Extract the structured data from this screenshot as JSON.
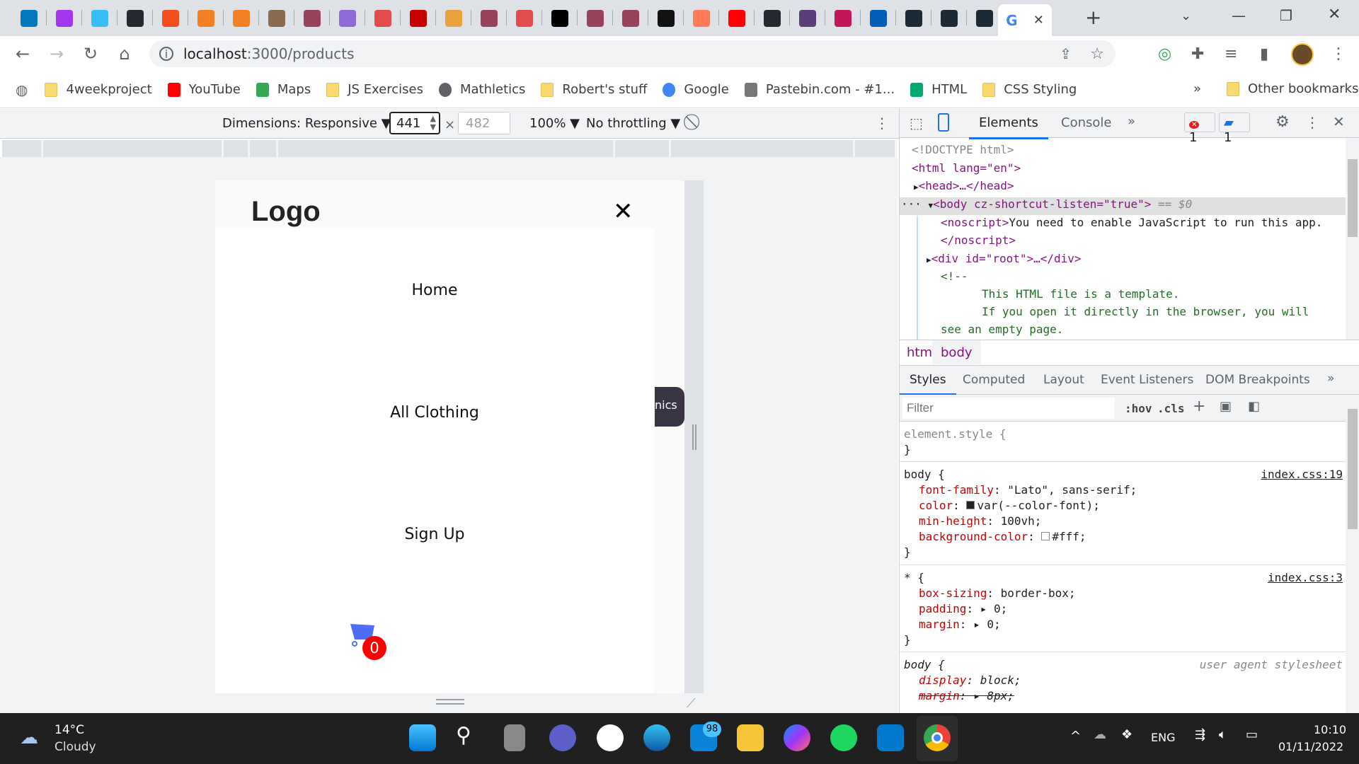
{
  "browser": {
    "tabs": [
      {
        "icon": "trello-icon",
        "color": "#0079bf"
      },
      {
        "icon": "udemy-icon",
        "color": "#a435f0"
      },
      {
        "icon": "tailwind-icon",
        "color": "#38bdf8"
      },
      {
        "icon": "github-icon",
        "color": "#24292f"
      },
      {
        "icon": "figma-icon",
        "color": "#f24e1e"
      },
      {
        "icon": "stackoverflow-icon",
        "color": "#f48024"
      },
      {
        "icon": "stackoverflow-icon",
        "color": "#f48024"
      },
      {
        "icon": "avatar-icon",
        "color": "#8a6a50"
      },
      {
        "icon": "jest-icon",
        "color": "#99425b"
      },
      {
        "icon": "graphql-icon",
        "color": "#8e6bd9"
      },
      {
        "icon": "octopus-icon",
        "color": "#e24c4c"
      },
      {
        "icon": "netlify-n-icon",
        "color": "#c40000"
      },
      {
        "icon": "colorful-eye-icon",
        "color": "#e9a23b"
      },
      {
        "icon": "jest-icon",
        "color": "#99425b"
      },
      {
        "icon": "octopus-icon",
        "color": "#e24c4c"
      },
      {
        "icon": "medium-icon",
        "color": "#000000"
      },
      {
        "icon": "jest-icon",
        "color": "#99425b"
      },
      {
        "icon": "jest-icon",
        "color": "#99425b"
      },
      {
        "icon": "codepen-icon",
        "color": "#111111"
      },
      {
        "icon": "hackerrank-icon",
        "color": "#ff7a59"
      },
      {
        "icon": "youtube-icon",
        "color": "#ff0000"
      },
      {
        "icon": "github-icon",
        "color": "#24292f"
      },
      {
        "icon": "calculator-icon",
        "color": "#5b3d7a"
      },
      {
        "icon": "arrow-icon",
        "color": "#c2185b"
      },
      {
        "icon": "scotland-flag-icon",
        "color": "#005eb8"
      },
      {
        "icon": "react-icon",
        "color": "#1b2a34"
      },
      {
        "icon": "react-icon",
        "color": "#1b2a34"
      },
      {
        "icon": "react-icon",
        "color": "#1b2a34"
      }
    ],
    "url_host": "localhost",
    "url_path": ":3000/products",
    "bookmarks": [
      {
        "label": "4weekproject",
        "icon": "folder"
      },
      {
        "label": "YouTube",
        "icon": "youtube"
      },
      {
        "label": "Maps",
        "icon": "maps"
      },
      {
        "label": "JS Exercises",
        "icon": "folder"
      },
      {
        "label": "Mathletics",
        "icon": "globe"
      },
      {
        "label": "Robert's stuff",
        "icon": "folder"
      },
      {
        "label": "Google",
        "icon": "google"
      },
      {
        "label": "Pastebin.com - #1...",
        "icon": "pastebin"
      },
      {
        "label": "HTML",
        "icon": "w3"
      },
      {
        "label": "CSS Styling",
        "icon": "folder"
      }
    ],
    "bookmarks_more": "»",
    "other_bookmarks": "Other bookmarks"
  },
  "device_toolbar": {
    "dimensions": "Dimensions: Responsive ▼",
    "width": "441",
    "height": "482",
    "times": "×",
    "zoom": "100% ▼",
    "throttling": "No throttling ▼"
  },
  "page": {
    "logo": "Logo",
    "close": "✕",
    "menu": [
      "Home",
      "All Clothing",
      "Sign Up"
    ],
    "cart_count": "0",
    "peek_tab": "nics",
    "cart_color": "#4f6ef7",
    "badge_color": "#ff0000"
  },
  "devtools": {
    "tabs": [
      "Elements",
      "Console",
      "»"
    ],
    "errors": "1",
    "messages": "1",
    "dom": {
      "doctype": "<!DOCTYPE html>",
      "html_open": "<html lang=\"en\">",
      "head": "<head>…</head>",
      "body": "<body cz-shortcut-listen=\"true\">",
      "body_suffix": " == $0",
      "noscript": "<noscript>",
      "noscript_text": "You need to enable JavaScript to run this app.",
      "noscript_close": "</noscript>",
      "root": "<div id=\"root\">…</div>",
      "comment_open": "<!--",
      "comment1": "This HTML file is a template.",
      "comment2": "If you open it directly in the browser, you will",
      "comment3": "see an empty page."
    },
    "breadcrumbs": [
      "html",
      "body"
    ],
    "style_tabs": [
      "Styles",
      "Computed",
      "Layout",
      "Event Listeners",
      "DOM Breakpoints",
      "»"
    ],
    "filter_placeholder": "Filter",
    "hov": ":hov",
    "cls": ".cls",
    "rules": {
      "element_style": "element.style {",
      "close": "}",
      "body_sel": "body {",
      "body_src": "index.css:19",
      "body_props": [
        {
          "name": "font-family",
          "value": "\"Lato\", sans-serif;"
        },
        {
          "name": "color",
          "value": "var(--color-font);"
        },
        {
          "name": "min-height",
          "value": "100vh;"
        },
        {
          "name": "background-color",
          "value": "#fff;"
        }
      ],
      "star_sel": "* {",
      "star_src": "index.css:3",
      "star_props": [
        {
          "name": "box-sizing",
          "value": "border-box;"
        },
        {
          "name": "padding",
          "value": "▸ 0;"
        },
        {
          "name": "margin",
          "value": "▸ 0;"
        }
      ],
      "ua_sel": "body {",
      "ua_src": "user agent stylesheet",
      "ua_props": [
        {
          "name": "display",
          "value": "block;"
        },
        {
          "name": "margin",
          "value": "▸ 8px;"
        }
      ]
    }
  },
  "taskbar": {
    "temp": "14°C",
    "weather": "Cloudy",
    "mail_badge": "98",
    "lang": "ENG",
    "time": "10:10",
    "date": "01/11/2022"
  }
}
